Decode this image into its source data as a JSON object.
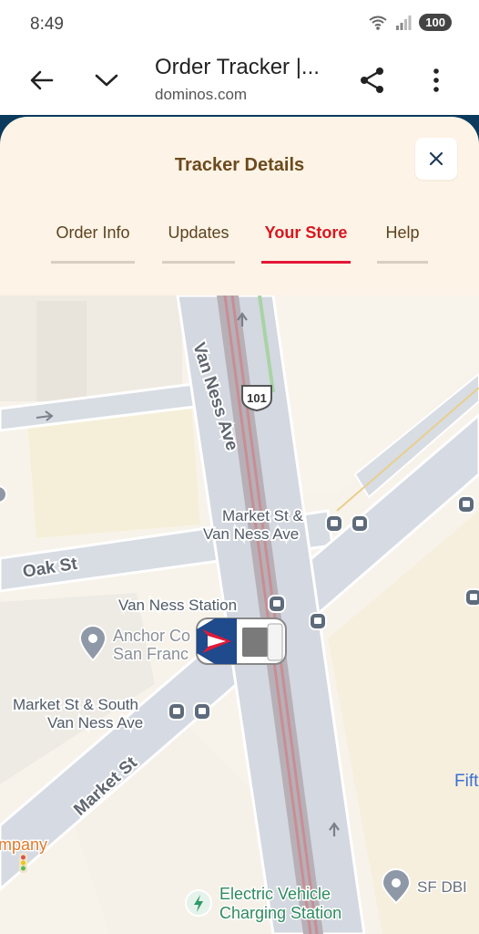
{
  "status": {
    "time": "8:49",
    "battery": "100"
  },
  "browser": {
    "title": "Order Tracker |...",
    "domain": "dominos.com"
  },
  "tracker": {
    "title": "Tracker Details",
    "tabs": [
      {
        "label": "Order Info",
        "active": false
      },
      {
        "label": "Updates",
        "active": false
      },
      {
        "label": "Your Store",
        "active": true
      },
      {
        "label": "Help",
        "active": false
      }
    ]
  },
  "map": {
    "streets": {
      "van_ness_ave": "Van Ness Ave",
      "oak_st": "Oak St",
      "market_st": "Market St",
      "highway": "101"
    },
    "stops": {
      "market_van_ness_1": "Market St &",
      "market_van_ness_2": "Van Ness Ave",
      "van_ness_station": "Van Ness Station",
      "market_south_1": "Market St & South",
      "market_south_2": "Van Ness Ave"
    },
    "places": {
      "anchor_1": "Anchor Co",
      "anchor_2": "San Franc",
      "company": "mpany",
      "ev_1": "Electric Vehicle",
      "ev_2": "Charging Station",
      "sf_dbi": "SF DBI",
      "fifth": "Fift"
    }
  },
  "colors": {
    "accent_red": "#e31837",
    "brand_blue": "#0b3a5c",
    "panel_bg": "#fdf3e6"
  }
}
